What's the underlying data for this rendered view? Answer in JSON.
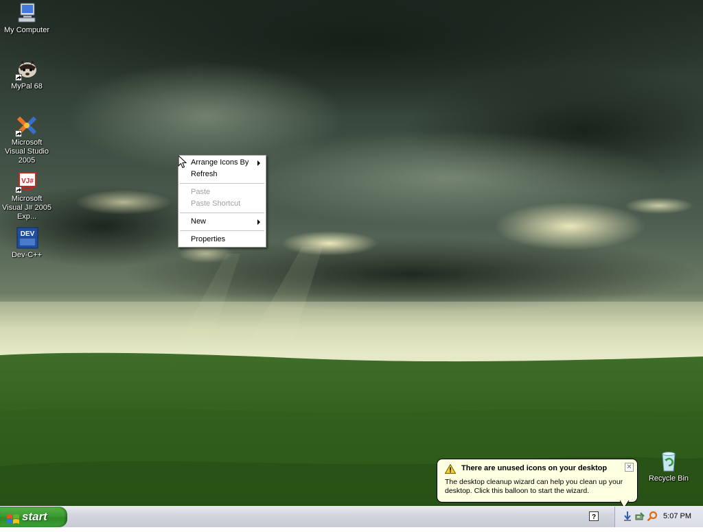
{
  "desktop": {
    "icons": [
      {
        "label": "My Computer",
        "icon": "my-computer-icon",
        "shortcut": false
      },
      {
        "label": "MyPal 68",
        "icon": "mypal-icon",
        "shortcut": true
      },
      {
        "label": "Microsoft Visual Studio 2005",
        "icon": "visual-studio-icon",
        "shortcut": true
      },
      {
        "label": "Microsoft Visual J# 2005 Exp...",
        "icon": "visual-jsharp-icon",
        "shortcut": true
      },
      {
        "label": "Dev-C++",
        "icon": "dev-cpp-icon",
        "shortcut": true
      },
      {
        "label": "Recycle Bin",
        "icon": "recycle-bin-icon",
        "shortcut": false
      }
    ],
    "icon_badges": {
      "jsharp": "VJ#",
      "devcpp": "DEV"
    }
  },
  "context_menu": {
    "items": [
      {
        "label": "Arrange Icons By",
        "submenu": true,
        "enabled": true
      },
      {
        "label": "Refresh",
        "submenu": false,
        "enabled": true
      },
      {
        "label": "Paste",
        "submenu": false,
        "enabled": false
      },
      {
        "label": "Paste Shortcut",
        "submenu": false,
        "enabled": false
      },
      {
        "label": "New",
        "submenu": true,
        "enabled": true
      },
      {
        "label": "Properties",
        "submenu": false,
        "enabled": true
      }
    ]
  },
  "taskbar": {
    "start_label": "start",
    "clock": "5:07 PM",
    "tray_icons": [
      "network-download-icon",
      "safely-remove-icon",
      "search-tray-icon"
    ],
    "help_icon_glyph": "?"
  },
  "balloon": {
    "title": "There are unused icons on your desktop",
    "text": "The desktop cleanup wizard can help you clean up your desktop. Click this balloon to start the wizard.",
    "close_glyph": "✕"
  },
  "colors": {
    "start_green": "#3c9b32",
    "balloon_bg": "#ffffe1",
    "menu_disabled": "#a0a0a0"
  }
}
